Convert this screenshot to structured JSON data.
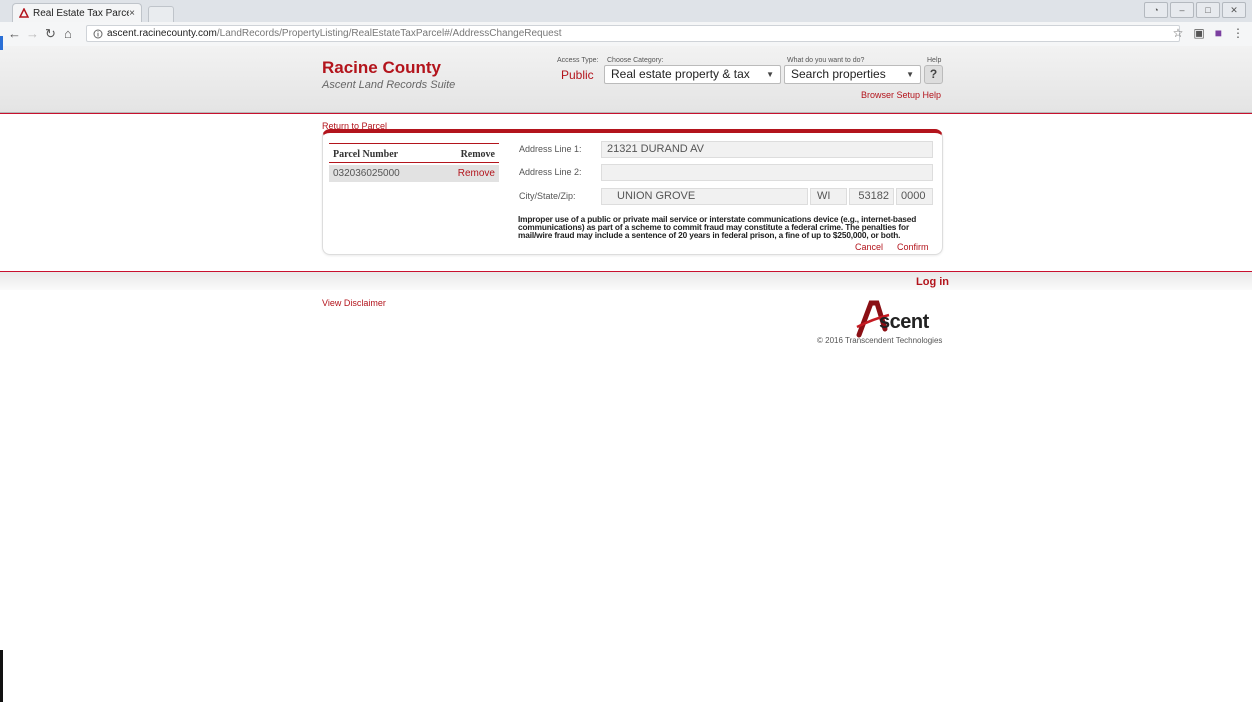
{
  "browser": {
    "tab_title": "Real Estate Tax Parcel",
    "tab_close": "×",
    "url_host": "ascent.racinecounty.com",
    "url_path": "/LandRecords/PropertyListing/RealEstateTaxParcel#/AddressChangeRequest"
  },
  "header": {
    "county_name": "Racine County",
    "suite_name": "Ascent Land Records Suite",
    "access_type_label": "Access Type:",
    "access_type_value": "Public",
    "category_label": "Choose Category:",
    "category_value": "Real estate property & tax",
    "action_label": "What do you want to do?",
    "action_value": "Search properties",
    "help_label": "Help",
    "help_button": "?",
    "browser_setup_link": "Browser Setup Help"
  },
  "return_link": "Return to Parcel",
  "parcel_table": {
    "headers": [
      "Parcel Number",
      "Remove"
    ],
    "rows": [
      {
        "parcel": "032036025000",
        "action": "Remove"
      }
    ]
  },
  "form": {
    "address1_label": "Address Line 1:",
    "address1_value": "21321 DURAND AV",
    "address2_label": "Address Line 2:",
    "address2_value": "",
    "csz_label": "City/State/Zip:",
    "city_value": "UNION GROVE",
    "state_value": "WI",
    "zip_value": "53182",
    "zip4_value": "0000",
    "warning": "Improper use of a public or private mail service or interstate communications device (e.g., internet-based communications) as part of a scheme to commit fraud may constitute a federal crime. The penalties for mail/wire fraud may include a sentence of 20 years in federal prison, a fine of up to $250,000, or both.",
    "cancel": "Cancel",
    "confirm": "Confirm"
  },
  "footer": {
    "login": "Log in",
    "disclaimer": "View Disclaimer",
    "logo_text": "scent",
    "copyright": "© 2016 Transcendent Technologies"
  },
  "colors": {
    "accent": "#b3141c"
  }
}
